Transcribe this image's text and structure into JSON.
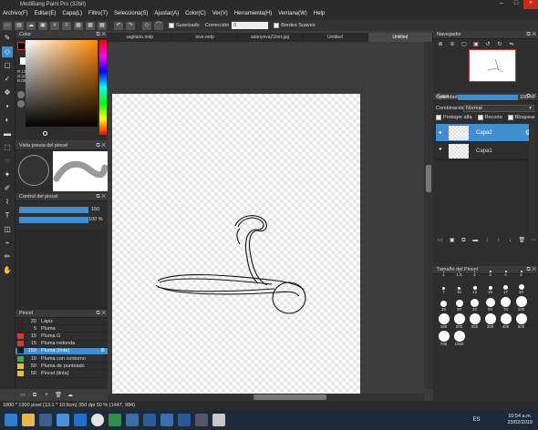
{
  "app": {
    "title": "MediBang Paint Pro (32bit)"
  },
  "menu": [
    "Archivo(F)",
    "Editar(E)",
    "Capa(L)",
    "Filtro(T)",
    "Selecciona(S)",
    "Ajustar(A)",
    "Color(C)",
    "Ver(V)",
    "Herramienta(H)",
    "Ventana(W)",
    "Help"
  ],
  "toolbar": {
    "suavizado": "Suavizado",
    "correccion": "Corrección",
    "correccion_value": "0",
    "bordes": "Bordes Suaves"
  },
  "tabs": [
    "sagitario.mdp",
    "love.mdp",
    "adanyeva21bet.jpg",
    "Untitled",
    "Untitled"
  ],
  "color_panel": {
    "title": "Color",
    "rgb": [
      "R:13",
      "G:10",
      "B:00"
    ]
  },
  "brush_preview": {
    "title": "Vista previa del pincel"
  },
  "brush_control": {
    "title": "Control del pincel",
    "size_value": "150",
    "opacity_value": "100 %"
  },
  "brush_panel": {
    "title": "Pincel",
    "items": [
      {
        "size": "20",
        "name": "Lápiz",
        "color": "#2a2a2a"
      },
      {
        "size": "5",
        "name": "Pluma",
        "color": "#2a2a2a"
      },
      {
        "size": "15",
        "name": "Pluma G",
        "color": "#d93a2b"
      },
      {
        "size": "15",
        "name": "Pluma redonda",
        "color": "#d93a2b"
      },
      {
        "size": "150",
        "name": "Pluma (tinta)",
        "color": "#1a1a1a"
      },
      {
        "size": "10",
        "name": "Pluma con contorno",
        "color": "#34b34a"
      },
      {
        "size": "50",
        "name": "Pluma de punteado",
        "color": "#e8c21a"
      },
      {
        "size": "50",
        "name": "Pincel (tinta)",
        "color": "#e8c21a"
      }
    ]
  },
  "navigator": {
    "title": "Navegador"
  },
  "layer_panel": {
    "title": "Capa",
    "opacity_label": "Opacidad",
    "opacity_value": "100 %",
    "blend_label": "Combinación",
    "blend_value": "Normal",
    "protect_alpha": "Proteger alfa",
    "clipping": "Recorte",
    "lock": "Bloquear",
    "layers": [
      "Capa2",
      "Capa1"
    ]
  },
  "brush_size_panel": {
    "title": "Tamaño del Pincel",
    "sizes": [
      "1",
      "1.5",
      "2",
      "3",
      "4",
      "5",
      "7",
      "10",
      "12",
      "15",
      "17",
      "20",
      "25",
      "30",
      "40",
      "50",
      "70",
      "100",
      "150",
      "200",
      "250",
      "300",
      "400",
      "500",
      "700",
      "1000"
    ]
  },
  "status": {
    "text": "1800 * 1300 pixel  (13.1 * 10.9cm)  350 dpi  50 %  (1447, 984)"
  },
  "taskbar": {
    "lang": "ES",
    "time": "10:54 a.m.",
    "date": "23/02/2019"
  },
  "colors": {
    "accent": "#3e8ed0",
    "fg": "#000000",
    "bg": "#ffffff"
  }
}
